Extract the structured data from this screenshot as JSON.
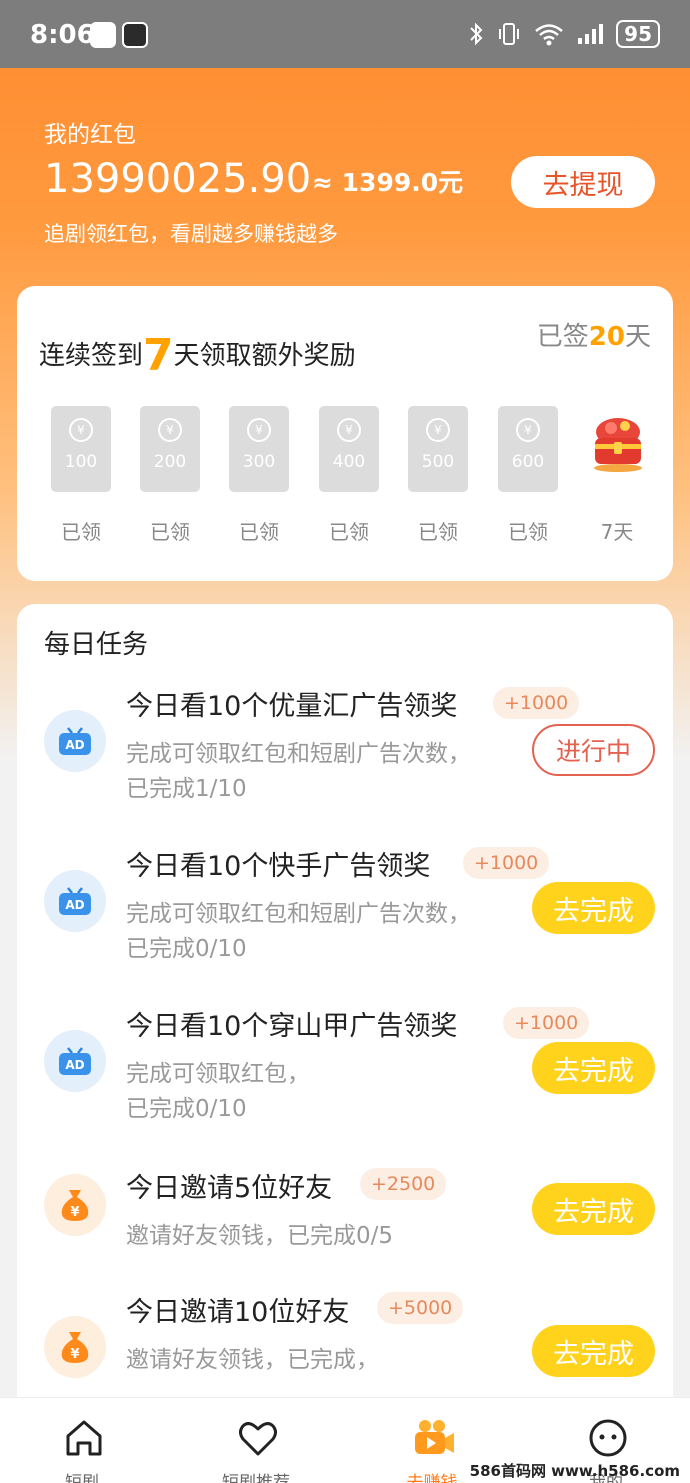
{
  "status_bar": {
    "time": "8:06",
    "battery": "95"
  },
  "wallet": {
    "title": "我的红包",
    "amount": "13990025.90",
    "approx": "≈ 1399.0元",
    "subtitle": "追剧领红包，看剧越多赚钱越多",
    "withdraw_label": "去提现"
  },
  "checkin": {
    "title_prefix": "连续签到",
    "title_days": "7",
    "title_suffix": "天领取额外奖励",
    "signed_prefix": "已签",
    "signed_days": "20",
    "signed_suffix": "天",
    "days": [
      {
        "amount": "100",
        "label": "已领"
      },
      {
        "amount": "200",
        "label": "已领"
      },
      {
        "amount": "300",
        "label": "已领"
      },
      {
        "amount": "400",
        "label": "已领"
      },
      {
        "amount": "500",
        "label": "已领"
      },
      {
        "amount": "600",
        "label": "已领"
      }
    ],
    "final_day_label": "7天",
    "coin_symbol": "¥"
  },
  "tasks": {
    "title": "每日任务",
    "items": [
      {
        "icon": "ad-tv-icon",
        "title": "今日看10个优量汇广告领奖",
        "reward": "+1000",
        "desc1": "完成可领取红包和短剧广告次数，",
        "desc2": "已完成1/10",
        "action": "进行中",
        "state": "in-progress"
      },
      {
        "icon": "ad-tv-icon",
        "title": "今日看10个快手广告领奖",
        "reward": "+1000",
        "desc1": "完成可领取红包和短剧广告次数，",
        "desc2": "已完成0/10",
        "action": "去完成",
        "state": "todo"
      },
      {
        "icon": "ad-tv-icon",
        "title": "今日看10个穿山甲广告领奖",
        "reward": "+1000",
        "desc1": "完成可领取红包，",
        "desc2": "已完成0/10",
        "action": "去完成",
        "state": "todo"
      },
      {
        "icon": "money-bag-icon",
        "title": "今日邀请5位好友",
        "reward": "+2500",
        "desc1": "邀请好友领钱，已完成0/5",
        "desc2": "",
        "action": "去完成",
        "state": "todo"
      },
      {
        "icon": "money-bag-icon",
        "title": "今日邀请10位好友",
        "reward": "+5000",
        "desc1": "邀请好友领钱，已完成，",
        "desc2": "",
        "action": "去完成",
        "state": "todo"
      }
    ]
  },
  "tabbar": {
    "tabs": [
      {
        "label": "短剧",
        "icon": "home-icon"
      },
      {
        "label": "短剧推荐",
        "icon": "heart-icon"
      },
      {
        "label": "去赚钱",
        "icon": "video-camera-icon",
        "active": true
      },
      {
        "label": "我的",
        "icon": "face-icon"
      }
    ]
  },
  "watermark": "586首码网 www.h586.com",
  "colors": {
    "accent": "#ff8a2e",
    "gold": "#ffa200",
    "button_yellow": "#ffd21c",
    "progress_red": "#e5614f"
  }
}
